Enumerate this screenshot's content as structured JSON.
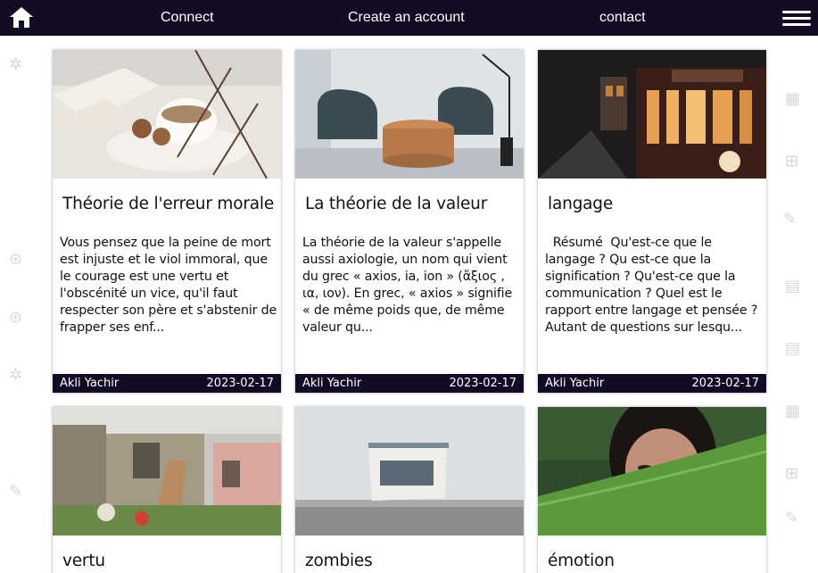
{
  "nav": {
    "links": [
      "Connect",
      "Create an account",
      "contact"
    ]
  },
  "colors": {
    "navbar": "#130a24",
    "card_footer": "#130a24"
  },
  "icons": {
    "home": "home-icon",
    "menu": "hamburger-menu-icon"
  },
  "articles": [
    {
      "title": "Théorie de l'erreur morale",
      "excerpt": "Vous pensez que la peine de mort est injuste et le viol immoral, que le courage est une vertu et l'obscénité un vice, qu'il faut respecter son père et s'abstenir de frapper ses enf...",
      "author": "Akli Yachir",
      "date": "2023-02-17"
    },
    {
      "title": "La théorie de la valeur",
      "excerpt": "La théorie de la valeur s'appelle aussi axiologie, un nom qui vient du grec « axios, ia, ion » (ἄξιος , ια, ιον). En grec, « axios » signifie « de même poids que, de même valeur qu...",
      "author": "Akli Yachir",
      "date": "2023-02-17"
    },
    {
      "title": "langage",
      "excerpt": "  Résumé  Qu'est-ce que le langage ? Qu est-ce que la signification ? Qu'est-ce que la communication ? Quel est le rapport entre langage et pensée ? Autant de questions sur lesqu...",
      "author": "Akli Yachir",
      "date": "2023-02-17"
    },
    {
      "title": "vertu"
    },
    {
      "title": "zombies"
    },
    {
      "title": "émotion"
    }
  ]
}
